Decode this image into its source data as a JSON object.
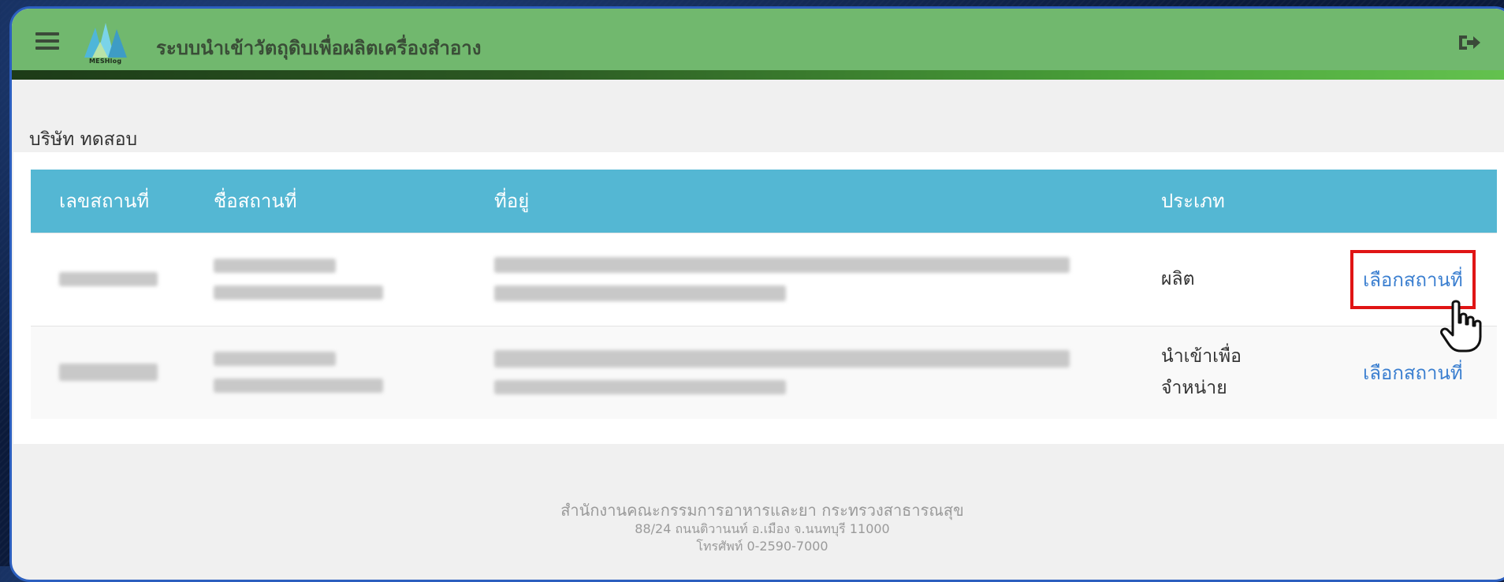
{
  "header": {
    "app_title": "ระบบนำเข้าวัตถุดิบเพื่อผลิตเครื่องสำอาง",
    "logo_text": "MESHlog",
    "menu_icon": "hamburger-menu-icon",
    "logout_icon": "sign-out-icon",
    "bar_color": "#71b86e"
  },
  "company": {
    "name": "บริษัท ทดสอบ"
  },
  "table": {
    "header_color": "#54b7d3",
    "columns": [
      "เลขสถานที่",
      "ชื่อสถานที่",
      "ที่อยู่",
      "ประเภท",
      ""
    ],
    "rows": [
      {
        "type": "ผลิต",
        "action": "เลือกสถานที่"
      },
      {
        "type_line1": "นำเข้าเพื่อ",
        "type_line2": "จำหน่าย",
        "action": "เลือกสถานที่"
      }
    ]
  },
  "footer": {
    "org": "สำนักงานคณะกรรมการอาหารและยา กระทรวงสาธารณสุข",
    "address": "88/24 ถนนติวานนท์ อ.เมือง จ.นนทบุรี 11000",
    "phone": "โทรศัพท์ 0-2590-7000"
  },
  "colors": {
    "link": "#3b7fd0",
    "highlight": "#e01515",
    "frame": "#2c5fbf"
  }
}
